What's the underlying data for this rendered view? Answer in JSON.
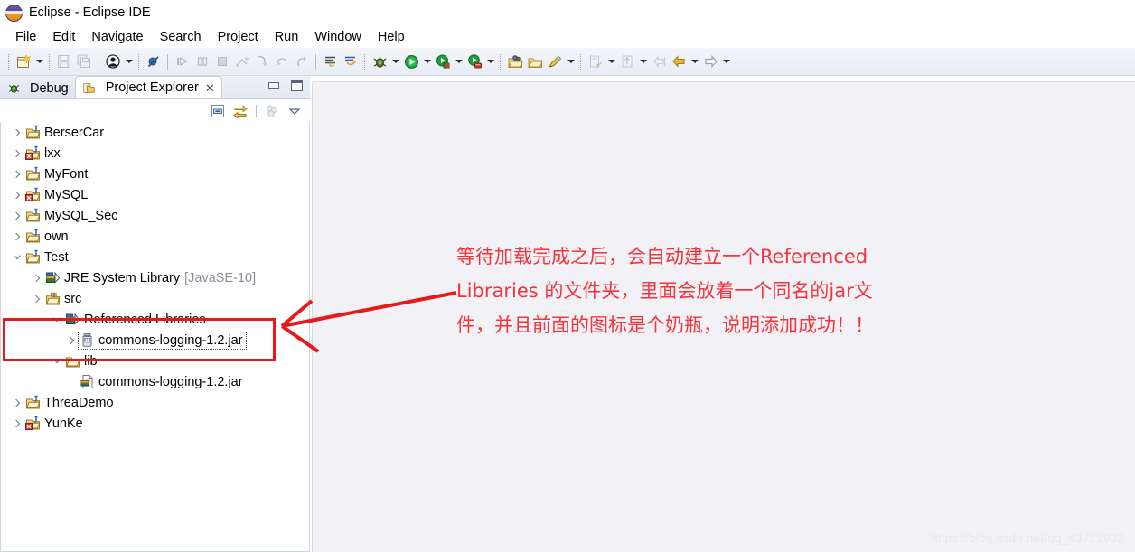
{
  "window": {
    "title": "Eclipse - Eclipse IDE",
    "icon": "eclipse-logo-icon"
  },
  "menubar": {
    "items": [
      {
        "label": "File"
      },
      {
        "label": "Edit"
      },
      {
        "label": "Navigate"
      },
      {
        "label": "Search"
      },
      {
        "label": "Project"
      },
      {
        "label": "Run"
      },
      {
        "label": "Window"
      },
      {
        "label": "Help"
      }
    ]
  },
  "toolbar": {
    "groups": [
      {
        "buttons": [
          {
            "name": "new-wizard-icon",
            "enabled": true
          },
          {
            "name": "dropdown-arrow",
            "type": "arrow"
          },
          {
            "name": "save-icon",
            "enabled": false
          },
          {
            "name": "save-all-icon",
            "enabled": false
          },
          {
            "name": "user-profile-icon",
            "enabled": true
          },
          {
            "name": "dropdown-arrow",
            "type": "arrow"
          }
        ]
      },
      {
        "buttons": [
          {
            "name": "skip-all-breakpoints-icon",
            "enabled": true
          }
        ]
      },
      {
        "buttons": [
          {
            "name": "resume-icon",
            "enabled": false
          },
          {
            "name": "suspend-icon",
            "enabled": false
          },
          {
            "name": "terminate-icon",
            "enabled": false
          },
          {
            "name": "disconnect-icon",
            "enabled": false
          },
          {
            "name": "step-into-icon",
            "enabled": false
          },
          {
            "name": "step-over-icon",
            "enabled": false
          },
          {
            "name": "step-return-icon",
            "enabled": false
          }
        ]
      },
      {
        "buttons": [
          {
            "name": "next-annotation-icon",
            "enabled": true
          },
          {
            "name": "previous-annotation-icon",
            "enabled": true
          }
        ]
      },
      {
        "buttons": [
          {
            "name": "debug-icon",
            "enabled": true
          },
          {
            "name": "dropdown-arrow",
            "type": "arrow"
          },
          {
            "name": "run-icon",
            "enabled": true
          },
          {
            "name": "dropdown-arrow",
            "type": "arrow"
          },
          {
            "name": "coverage-icon",
            "enabled": true
          },
          {
            "name": "dropdown-arrow",
            "type": "arrow"
          },
          {
            "name": "external-tools-icon",
            "enabled": true
          },
          {
            "name": "dropdown-arrow",
            "type": "arrow"
          }
        ]
      },
      {
        "buttons": [
          {
            "name": "new-java-package-icon",
            "enabled": true
          },
          {
            "name": "open-type-icon",
            "enabled": true
          },
          {
            "name": "new-java-class-icon",
            "enabled": true
          },
          {
            "name": "dropdown-arrow",
            "type": "arrow"
          }
        ]
      },
      {
        "buttons": [
          {
            "name": "open-task-icon",
            "enabled": false
          },
          {
            "name": "dropdown-arrow",
            "type": "arrow"
          },
          {
            "name": "activate-task-icon",
            "enabled": false
          },
          {
            "name": "dropdown-arrow",
            "type": "arrow"
          },
          {
            "name": "back-to-icon",
            "enabled": false
          },
          {
            "name": "back-icon",
            "enabled": true
          },
          {
            "name": "dropdown-arrow",
            "type": "arrow"
          },
          {
            "name": "forward-icon",
            "enabled": false
          },
          {
            "name": "dropdown-arrow",
            "type": "arrow"
          }
        ]
      }
    ]
  },
  "view": {
    "tabs": [
      {
        "label": "Debug",
        "icon": "debug-bug-icon",
        "active": false,
        "closable": false
      },
      {
        "label": "Project Explorer",
        "icon": "project-explorer-icon",
        "active": true,
        "closable": true,
        "close_glyph": "✕"
      }
    ],
    "panel_buttons": [
      {
        "name": "minimize-button"
      },
      {
        "name": "maximize-button"
      }
    ],
    "view_toolbar": [
      {
        "name": "collapse-all-icon"
      },
      {
        "name": "link-with-editor-icon"
      },
      {
        "name": "focus-on-active-task-icon"
      },
      {
        "name": "view-menu-icon"
      }
    ]
  },
  "tree": {
    "items": [
      {
        "label": "BerserCar",
        "icon": "java-project-icon",
        "indent": 0,
        "twisty": "collapsed",
        "error": false
      },
      {
        "label": "lxx",
        "icon": "java-project-icon",
        "indent": 0,
        "twisty": "collapsed",
        "error": true
      },
      {
        "label": "MyFont",
        "icon": "java-project-icon",
        "indent": 0,
        "twisty": "collapsed",
        "error": false
      },
      {
        "label": "MySQL",
        "icon": "java-project-icon",
        "indent": 0,
        "twisty": "collapsed",
        "error": true
      },
      {
        "label": "MySQL_Sec",
        "icon": "java-project-icon",
        "indent": 0,
        "twisty": "collapsed",
        "error": false
      },
      {
        "label": "own",
        "icon": "java-project-icon",
        "indent": 0,
        "twisty": "collapsed",
        "error": false
      },
      {
        "label": "Test",
        "icon": "java-project-icon",
        "indent": 0,
        "twisty": "expanded",
        "error": false
      },
      {
        "label": "JRE System Library",
        "suffix": "[JavaSE-10]",
        "icon": "jre-library-icon",
        "indent": 1,
        "twisty": "collapsed",
        "error": false
      },
      {
        "label": "src",
        "icon": "source-folder-icon",
        "indent": 1,
        "twisty": "collapsed",
        "error": false
      },
      {
        "label": "Referenced Libraries",
        "icon": "referenced-libraries-icon",
        "indent": 2,
        "twisty": "expanded",
        "error": false
      },
      {
        "label": "commons-logging-1.2.jar",
        "icon": "jar-bottle-icon",
        "indent": 3,
        "twisty": "collapsed",
        "error": false,
        "selected": true
      },
      {
        "label": "lib",
        "icon": "folder-icon",
        "indent": 2,
        "twisty": "expanded",
        "error": false
      },
      {
        "label": "commons-logging-1.2.jar",
        "icon": "jar-file-icon",
        "indent": 4,
        "twisty": "none",
        "error": false
      },
      {
        "label": "ThreaDemo",
        "icon": "java-project-icon",
        "indent": 0,
        "twisty": "collapsed",
        "error": false
      },
      {
        "label": "YunKe",
        "icon": "java-project-icon",
        "indent": 0,
        "twisty": "collapsed",
        "error": true
      }
    ]
  },
  "annotation": {
    "color": "#f5333a",
    "box_color": "#e81919",
    "lines": [
      "等待加载完成之后，会自动建立一个Referenced",
      "Libraries 的文件夹，里面会放着一个同名的jar文",
      "件，并且前面的图标是个奶瓶，说明添加成功！！"
    ],
    "arrow_name": "red-pointer-arrow",
    "box_name": "red-highlight-box"
  },
  "watermark": {
    "text": "https://blog.csdn.net/qq_43719932"
  }
}
